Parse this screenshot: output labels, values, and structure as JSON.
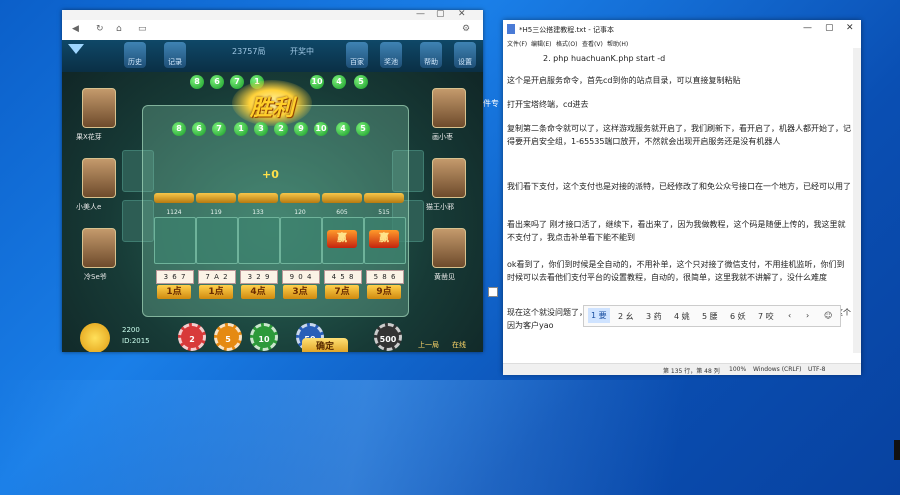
{
  "desktop": {
    "side_label": "件专"
  },
  "game": {
    "topbar": {
      "left_buttons": [
        "历史",
        "记录"
      ],
      "room_no": "23757局",
      "status": "开奖中",
      "right_buttons": [
        "百家",
        "奖池",
        "帮助",
        "设置"
      ]
    },
    "history_top": [
      "8",
      "6",
      "7",
      "1",
      "3",
      "2",
      "9",
      "10",
      "4",
      "5"
    ],
    "history_panel": [
      "8",
      "6",
      "7",
      "1",
      "3",
      "2",
      "9",
      "10",
      "4",
      "5"
    ],
    "win_title": "胜利",
    "win_amount": "+0",
    "columns": [
      {
        "value": "1124",
        "hand": "3 6 7",
        "points": "1点",
        "win": false
      },
      {
        "value": "119",
        "hand": "7 A 2",
        "points": "1点",
        "win": false
      },
      {
        "value": "133",
        "hand": "3 2 9",
        "points": "4点",
        "win": false
      },
      {
        "value": "120",
        "hand": "9 0 4",
        "points": "3点",
        "win": false
      },
      {
        "value": "605",
        "hand": "4 5 8",
        "points": "7点",
        "win": true
      },
      {
        "value": "515",
        "hand": "5 8 6",
        "points": "9点",
        "win": true
      }
    ],
    "win_badge": "赢",
    "players_left": [
      "果X花芽",
      "小美人e",
      "冷Se爷"
    ],
    "players_right": [
      "画小枣",
      "猫王小邪",
      "黄凿见"
    ],
    "self": {
      "score": "2200",
      "id": "ID:2015"
    },
    "chips": [
      "2",
      "5",
      "10",
      "50",
      "500"
    ],
    "confirm_label": "确定",
    "bottom_right": [
      "上一局",
      "在线"
    ]
  },
  "notepad": {
    "title": "*H5三公搭建教程.txt - 记事本",
    "menu": [
      "文件(F)",
      "编辑(E)",
      "格式(O)",
      "查看(V)",
      "帮助(H)"
    ],
    "lines": [
      "2.    php huachuanK.php start -d",
      "这个是开启服务命令，首先cd到你的站点目录，可以直接复制粘贴",
      "打开宝塔终端，cd进去",
      "复制第二条命令就可以了，这样游戏服务就开启了，我们刷新下，看开启了，机器人都开始了，记得要开启安全组，1-65535端口放开，不然就会出现开启服务还是没有机器人",
      "我们看下支付，这个支付也是对接的派特，已经修改了和免公众号接口在一个地方，已经可以用了",
      "看出来吗了 刚才接口活了，继续下，看出来了，因为我做教程，这个码是随便上传的，我这里就不支付了，我点击补单看下能不能到",
      "ok看到了，你们到时候是全自动的，不用补单，这个只对接了微信支付，不用挂机监听，你们到时候可以去看他们支付平台的设置教程，自动的，很简单，这里我就不讲解了，没什么难度",
      "现在这个就没问题了，其他的你们自行研究吧，他这个免公众号接口很不错，支持防风，但是这个因为客户yao"
    ],
    "ime_candidates": [
      "1 要",
      "2 幺",
      "3 药",
      "4 姚",
      "5 腰",
      "6 妖",
      "7 咬"
    ],
    "status": {
      "position": "第 135 行，第 48 列",
      "zoom": "100%",
      "eol": "Windows (CRLF)",
      "encoding": "UTF-8"
    }
  }
}
